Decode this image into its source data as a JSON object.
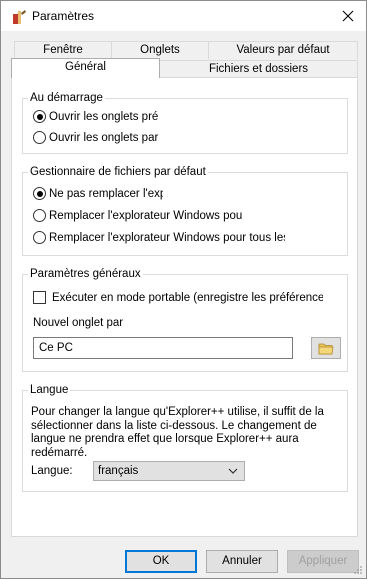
{
  "window": {
    "title": "Paramètres"
  },
  "tabs_back": [
    "Fenêtre",
    "Onglets",
    "Valeurs par défaut"
  ],
  "tabs_front": [
    "Général",
    "Fichiers et dossiers"
  ],
  "startup": {
    "title": "Au démarrage",
    "options": [
      "Ouvrir les onglets pré",
      "Ouvrir les onglets par"
    ],
    "selected": 0
  },
  "file_manager": {
    "title": "Gestionnaire de fichiers par défaut",
    "options": [
      "Ne pas remplacer l'explo",
      "Remplacer l'explorateur Windows pour le",
      "Remplacer l'explorateur Windows pour tous les do"
    ],
    "selected": 0
  },
  "general": {
    "title": "Paramètres généraux",
    "portable_label": "Exécuter en mode portable (enregistre les préférence",
    "new_tab_label": "Nouvel onglet par",
    "new_tab_value": "Ce PC"
  },
  "language": {
    "title": "Langue",
    "description": "Pour changer la langue qu'Explorer++ utilise, il suffit de la sélectionner dans la liste ci-dessous. Le changement de langue ne prendra effet que lorsque Explorer++ aura redémarré.",
    "label": "Langue:",
    "selected": "français"
  },
  "buttons": {
    "ok": "OK",
    "cancel": "Annuler",
    "apply": "Appliquer"
  }
}
